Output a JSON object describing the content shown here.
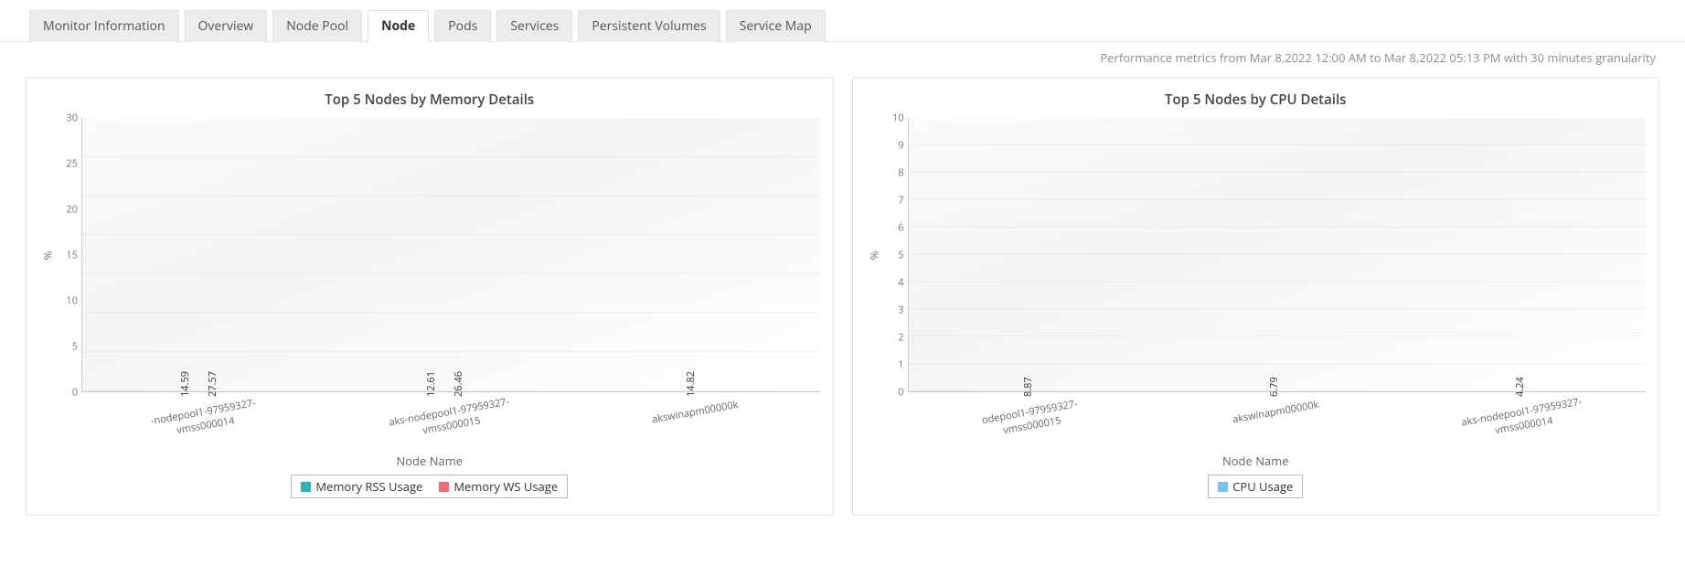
{
  "tabs": [
    {
      "label": "Monitor Information",
      "name": "tab-monitor-info",
      "active": false
    },
    {
      "label": "Overview",
      "name": "tab-overview",
      "active": false
    },
    {
      "label": "Node Pool",
      "name": "tab-node-pool",
      "active": false
    },
    {
      "label": "Node",
      "name": "tab-node",
      "active": true
    },
    {
      "label": "Pods",
      "name": "tab-pods",
      "active": false
    },
    {
      "label": "Services",
      "name": "tab-services",
      "active": false
    },
    {
      "label": "Persistent Volumes",
      "name": "tab-pv",
      "active": false
    },
    {
      "label": "Service Map",
      "name": "tab-service-map",
      "active": false
    }
  ],
  "subtext": "Performance metrics from Mar 8,2022 12:00 AM to Mar 8,2022 05:13 PM with 30 minutes granularity",
  "mem": {
    "title": "Top 5 Nodes by Memory Details",
    "ylabel": "%",
    "xlabel": "Node Name",
    "legend": [
      "Memory RSS Usage",
      "Memory WS Usage"
    ],
    "colors": [
      "#2bb4bb",
      "#ed6f73"
    ]
  },
  "cpu": {
    "title": "Top 5 Nodes by CPU Details",
    "ylabel": "%",
    "xlabel": "Node Name",
    "legend": [
      "CPU Usage"
    ],
    "colors": [
      "#78c3ea"
    ]
  },
  "chart_data": [
    {
      "id": "mem",
      "type": "bar",
      "title": "Top 5 Nodes by Memory Details",
      "xlabel": "Node Name",
      "ylabel": "%",
      "ylim": [
        0,
        30
      ],
      "yticks": [
        0,
        5,
        10,
        15,
        20,
        25,
        30
      ],
      "categories": [
        "-nodepool1-97959327-\nvmss000014",
        "aks-nodepool1-97959327-\nvmss000015",
        "akswinapm00000k"
      ],
      "series": [
        {
          "name": "Memory RSS Usage",
          "values": [
            14.59,
            12.61,
            null
          ]
        },
        {
          "name": "Memory WS Usage",
          "values": [
            27.57,
            26.46,
            14.82
          ]
        }
      ],
      "legend_position": "bottom",
      "grid": true
    },
    {
      "id": "cpu",
      "type": "bar",
      "title": "Top 5 Nodes by CPU Details",
      "xlabel": "Node Name",
      "ylabel": "%",
      "ylim": [
        0,
        10
      ],
      "yticks": [
        0,
        1,
        2,
        3,
        4,
        5,
        6,
        7,
        8,
        9,
        10
      ],
      "categories": [
        "odepool1-97959327-\nvmss000015",
        "akswinapm00000k",
        "aks-nodepool1-97959327-\nvmss000014"
      ],
      "series": [
        {
          "name": "CPU Usage",
          "values": [
            8.87,
            6.79,
            4.24
          ]
        }
      ],
      "legend_position": "bottom",
      "grid": true
    }
  ]
}
